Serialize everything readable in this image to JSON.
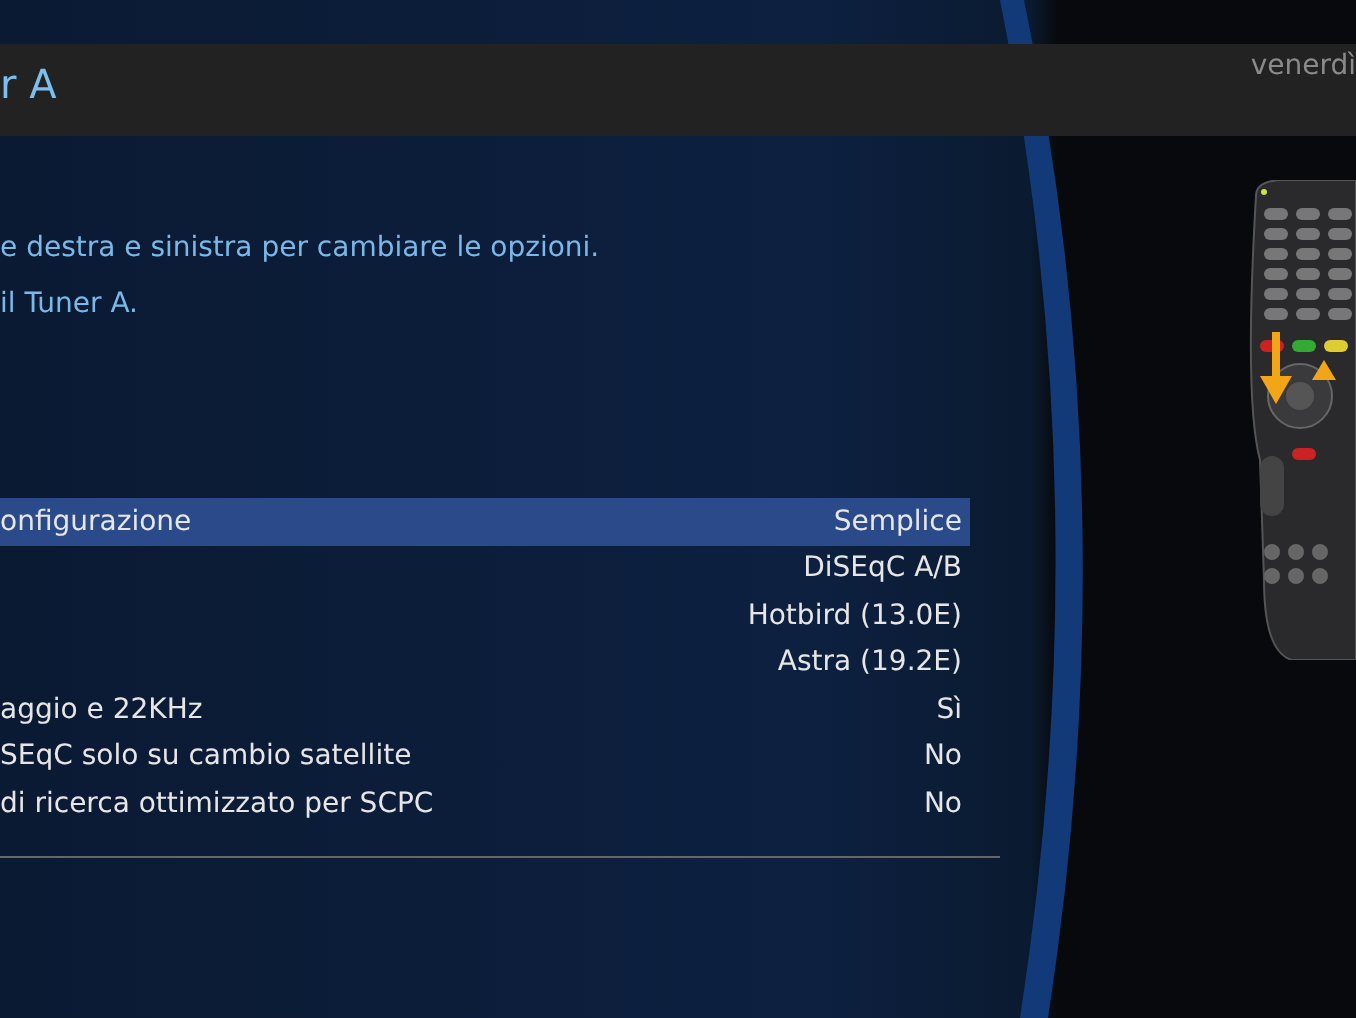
{
  "header": {
    "title": "r A",
    "date": "venerdì"
  },
  "help_lines": [
    "e destra e sinistra per cambiare le opzioni.",
    "il Tuner A."
  ],
  "settings": [
    {
      "label": "onfigurazione",
      "value": "Semplice",
      "selected": true
    },
    {
      "value": "DiSEqC A/B",
      "selected": false
    },
    {
      "value": "Hotbird (13.0E)",
      "selected": false
    },
    {
      "value": "Astra (19.2E)",
      "selected": false
    },
    {
      "label": "aggio e 22KHz",
      "value": "Sì",
      "selected": false
    },
    {
      "label": "SEqC solo su cambio satellite",
      "value": "No",
      "selected": false
    },
    {
      "label": "di ricerca ottimizzato per SCPC",
      "value": "No",
      "selected": false
    }
  ]
}
